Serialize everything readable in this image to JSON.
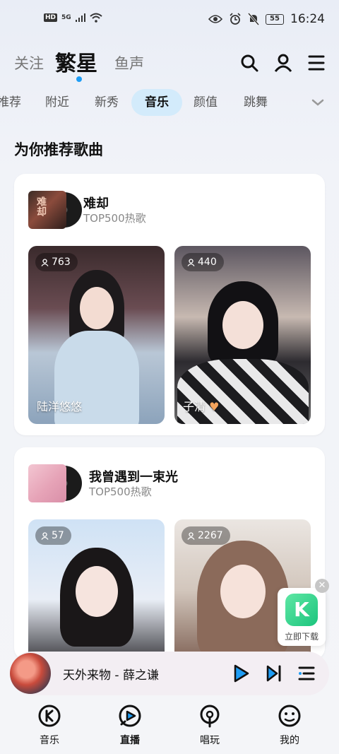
{
  "status_bar": {
    "left_badges": [
      "HD",
      "5G"
    ],
    "battery": "55",
    "time": "16:24"
  },
  "header": {
    "tabs": [
      "关注",
      "繁星",
      "鱼声"
    ],
    "active_tab": "繁星",
    "icons": [
      "search-icon",
      "profile-icon",
      "menu-icon"
    ]
  },
  "categories": {
    "items": [
      "推荐",
      "附近",
      "新秀",
      "音乐",
      "颜值",
      "跳舞"
    ],
    "active": "音乐"
  },
  "section": {
    "title": "为你推荐歌曲"
  },
  "cards": [
    {
      "album_text": "难却",
      "song": "难却",
      "subtitle": "TOP500热歌",
      "tiles": [
        {
          "viewers": "763",
          "anchor": "陆洋悠悠"
        },
        {
          "viewers": "440",
          "anchor": "子清"
        }
      ]
    },
    {
      "song": "我曾遇到一束光",
      "subtitle": "TOP500热歌",
      "tiles": [
        {
          "viewers": "57",
          "anchor": ""
        },
        {
          "viewers": "2267",
          "anchor": ""
        }
      ]
    }
  ],
  "download_float": {
    "label": "立即下载",
    "logo": "K"
  },
  "player": {
    "title": "天外来物  -  薛之谦"
  },
  "bottom_nav": {
    "items": [
      "音乐",
      "直播",
      "唱玩",
      "我的"
    ],
    "active": "直播"
  },
  "colors": {
    "accent": "#1e9df5",
    "active_pill": "#d3ebfb",
    "player_icon": "#1e9df5"
  }
}
